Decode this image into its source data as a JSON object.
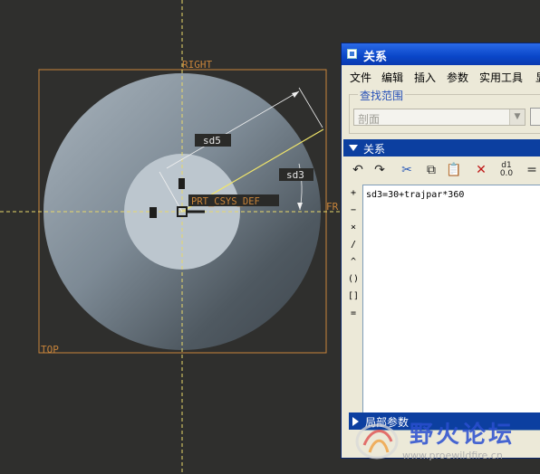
{
  "sketch": {
    "right_label": "RIGHT",
    "top_label": "TOP",
    "front_label": "FR",
    "csys_label": "PRT_CSYS_DEF",
    "dim_sd5": "sd5",
    "dim_sd3": "sd3",
    "colors": {
      "background": "#2f2f2d",
      "datum": "#c8843a",
      "centerline": "#e8d86a",
      "disk_outer": "#8e9ba6",
      "disk_inner": "#c4ccd4"
    }
  },
  "dialog": {
    "title": "关系",
    "menus": [
      "文件",
      "编辑",
      "插入",
      "参数",
      "实用工具",
      "显"
    ],
    "scope_legend": "查找范围",
    "scope_value": "剖面",
    "relations_header": "关系",
    "toolbar_icons": [
      "undo-icon",
      "redo-icon",
      "cut-icon",
      "copy-icon",
      "paste-icon",
      "delete-icon",
      "switch-dims-icon",
      "eval-icon"
    ],
    "switch_dims_label": "d1\n0.0",
    "operators": [
      "+",
      "−",
      "×",
      "/",
      "^",
      "()",
      "[]",
      "="
    ],
    "relation_text": "sd3=30+trajpar*360",
    "local_params_header": "局部参数"
  },
  "watermark": {
    "title": "野火论坛",
    "url": "www.proewildfire.cn"
  }
}
